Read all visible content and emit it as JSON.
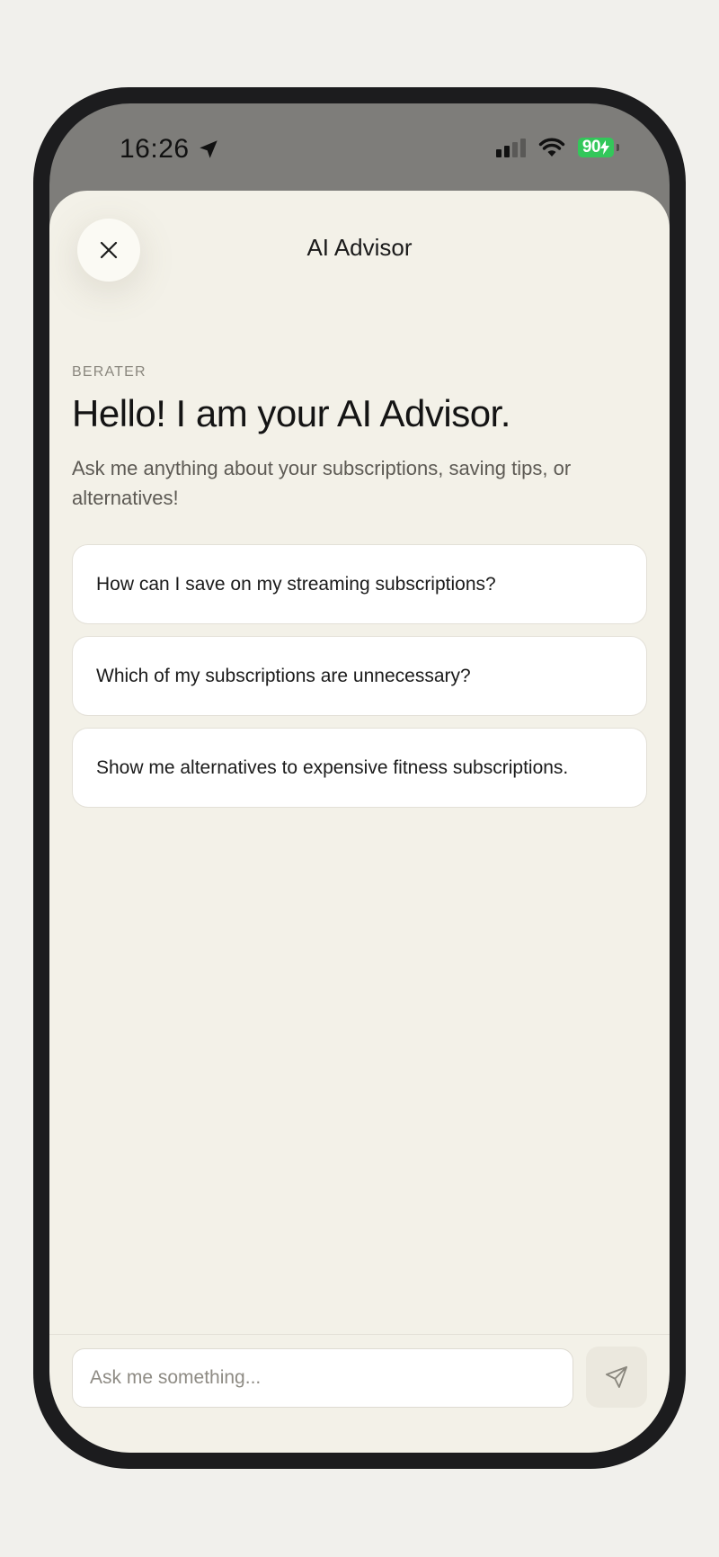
{
  "status_bar": {
    "time": "16:26",
    "battery": "90"
  },
  "header": {
    "title": "AI Advisor"
  },
  "intro": {
    "eyebrow": "BERATER",
    "headline": "Hello! I am your AI Advisor.",
    "subtitle": "Ask me anything about your subscriptions, saving tips, or alternatives!"
  },
  "suggestions": [
    "How can I save on my streaming subscriptions?",
    "Which of my subscriptions are unnecessary?",
    "Show me alternatives to expensive fitness subscriptions."
  ],
  "composer": {
    "placeholder": "Ask me something..."
  },
  "colors": {
    "background": "#f3f1e8",
    "status_bar": "#7e7d7a",
    "battery": "#33c75a",
    "card": "#ffffff"
  },
  "icons": {
    "close": "close-icon",
    "send": "send-icon",
    "location": "location-arrow-icon",
    "wifi": "wifi-icon",
    "signal": "cellular-signal-icon"
  }
}
